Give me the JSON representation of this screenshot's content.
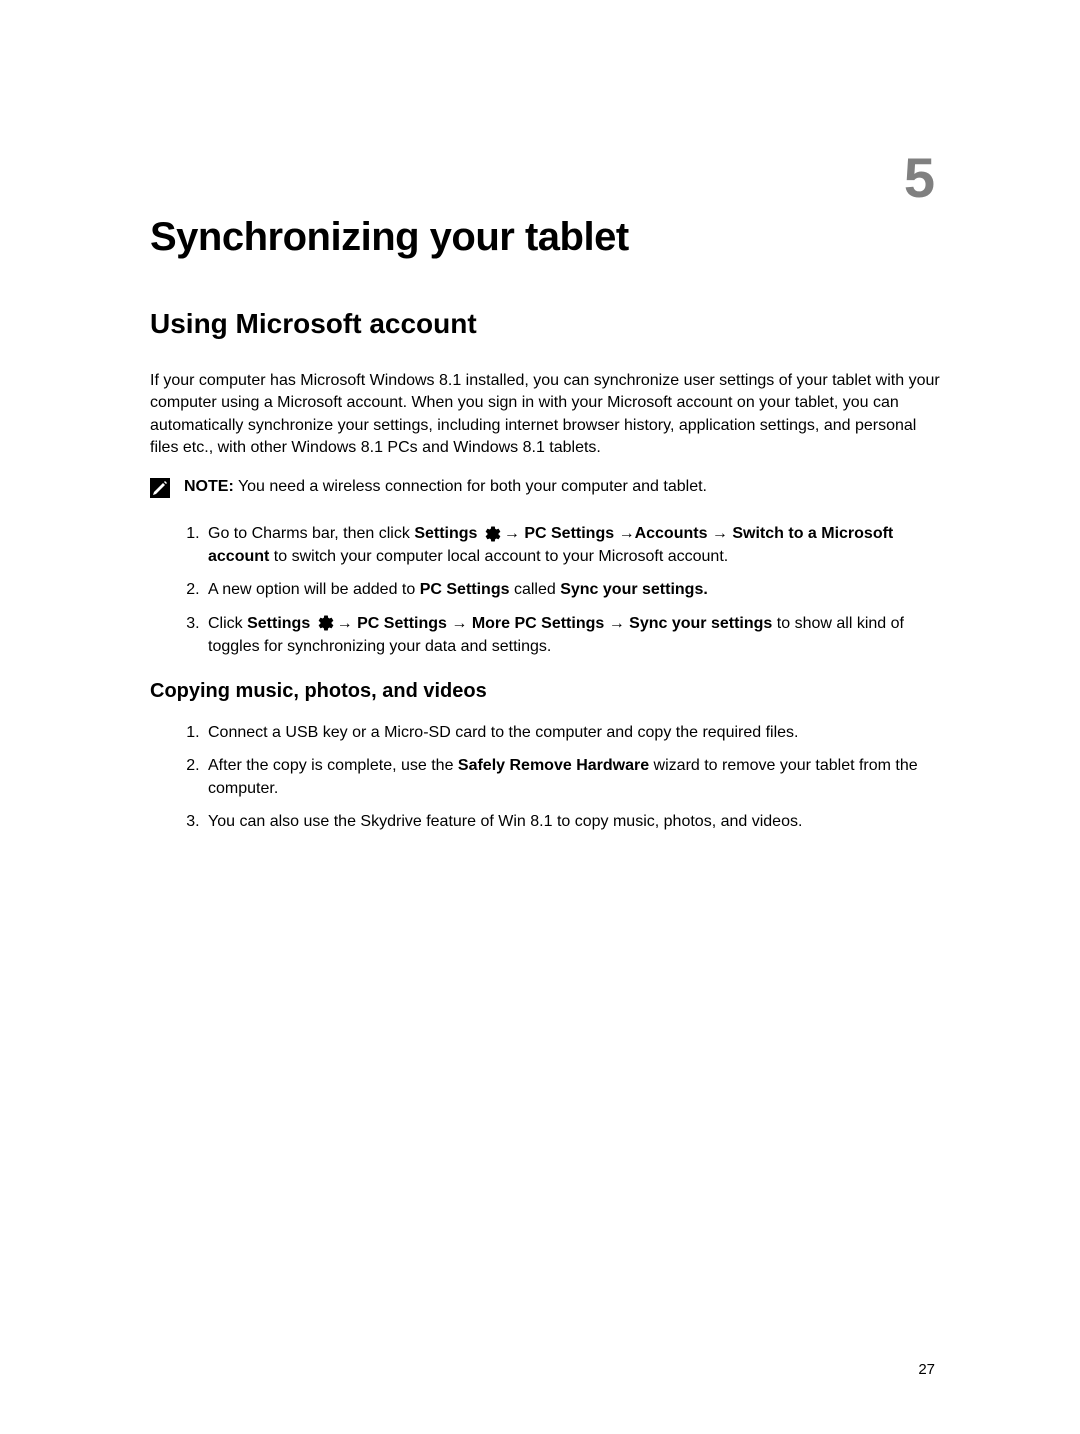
{
  "chapter_number": "5",
  "title": "Synchronizing your tablet",
  "section1": {
    "heading": "Using Microsoft account",
    "intro": "If your computer has Microsoft Windows 8.1 installed, you can synchronize user settings of your tablet with your computer using a Microsoft account. When you sign in with your Microsoft account on your tablet, you can automatically synchronize your settings, including internet browser history, application settings, and personal files etc., with other Windows 8.1 PCs and Windows 8.1 tablets.",
    "note_label": "NOTE:",
    "note_text": " You need a wireless connection for both your computer and tablet.",
    "steps": {
      "s1_pre": "Go to Charms bar, then click ",
      "s1_b1": "Settings ",
      "s1_arrow": "→ ",
      "s1_b2": "PC Settings ",
      "s1_mid1": "→",
      "s1_b3": "Accounts ",
      "s1_mid2": "→ ",
      "s1_b4": "Switch to a Microsoft account",
      "s1_post": " to switch your computer local account to your Microsoft account.",
      "s2_pre": "A new option will be added to ",
      "s2_b1": "PC Settings",
      "s2_mid": " called ",
      "s2_b2": "Sync your settings.",
      "s3_pre": "Click ",
      "s3_b1": "Settings ",
      "s3_arrow": "→ ",
      "s3_b2": "PC Settings ",
      "s3_mid1": "→ ",
      "s3_b3": "More PC Settings ",
      "s3_mid2": "→ ",
      "s3_b4": "Sync your settings",
      "s3_post": " to show all kind of toggles for synchronizing your data and settings."
    }
  },
  "section2": {
    "heading": "Copying music, photos, and videos",
    "steps": {
      "s1": "Connect a USB key or a Micro-SD card to the computer and copy the required files.",
      "s2_pre": "After the copy is complete, use the ",
      "s2_b1": "Safely Remove Hardware",
      "s2_post": " wizard to remove your tablet from the computer.",
      "s3": "You can also use the Skydrive feature of Win 8.1 to copy music, photos, and videos."
    }
  },
  "page_number": "27"
}
